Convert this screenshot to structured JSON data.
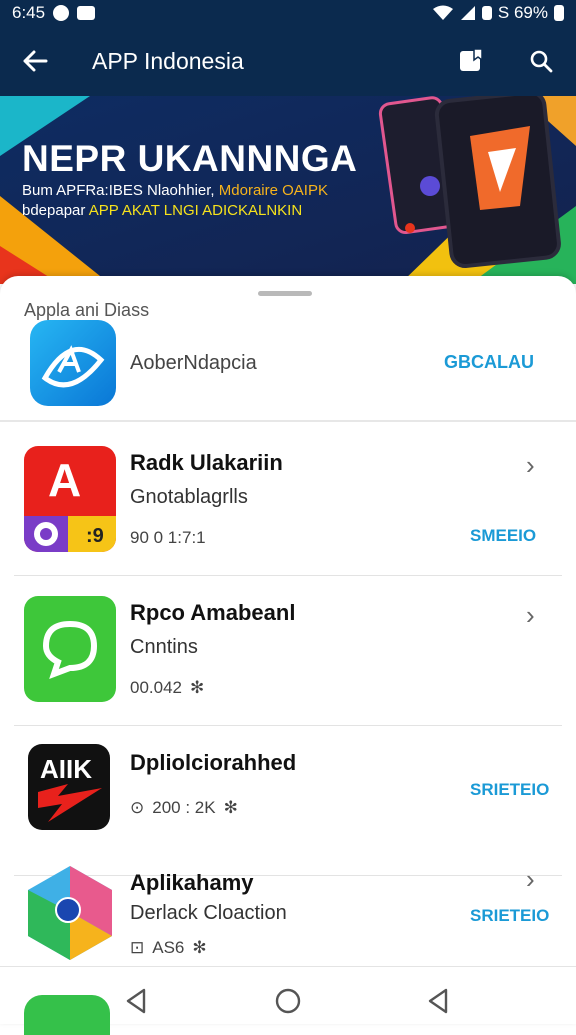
{
  "status_bar": {
    "time": "6:45",
    "battery": "S 69%"
  },
  "app_bar": {
    "title": "APP Indonesia"
  },
  "banner": {
    "headline": "NEPR UKANNNGA",
    "line1_white": "Bum APFRa:IBES Nlaohhier, ",
    "line1_accent": "Mdoraire OAIPK",
    "line2_white": "bdepapar ",
    "line2_accent": "APP AKAT LNGI ADICKALNKIN"
  },
  "sheet": {
    "section_title": "Appla ani Diass",
    "featured": {
      "name": "AoberNdapcia",
      "button": "GBCALAU"
    },
    "apps": [
      {
        "name": "Radk Ulakariin",
        "subtitle": "Gnotablagrlls",
        "meta": "90 0 1:7:1",
        "action": "SMEEIO"
      },
      {
        "name": "Rpco Amabeanl",
        "subtitle": "Cnntins",
        "meta": "00.042",
        "action": ""
      },
      {
        "name": "Dpliolciorahhed",
        "subtitle": "",
        "meta": "200 : 2K",
        "action": "SRIETEIO"
      },
      {
        "name": "Aplikahamy",
        "subtitle": "Derlack Cloaction",
        "meta": "AS6",
        "action": "SRIETEIO"
      }
    ]
  },
  "colors": {
    "primary": "#0b2a4e",
    "accent": "#1b9ad6"
  },
  "icons": [
    "back-arrow-icon",
    "bookmark-icon",
    "search-icon",
    "chevron-right-icon",
    "back-nav-icon",
    "home-nav-icon",
    "recents-nav-icon"
  ]
}
